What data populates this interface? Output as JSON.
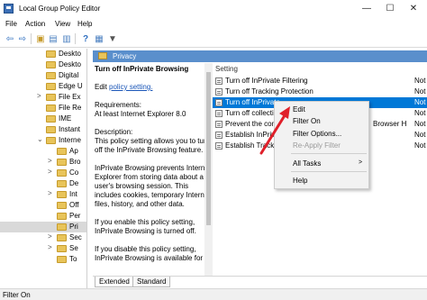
{
  "window": {
    "title": "Local Group Policy Editor",
    "minimize_glyph": "—",
    "maximize_glyph": "☐",
    "close_glyph": "✕"
  },
  "menu": [
    "File",
    "Action",
    "View",
    "Help"
  ],
  "toolbar": {
    "icons": [
      "back-arrow-icon",
      "forward-arrow-icon",
      "folder-up-icon",
      "show-tree-icon",
      "export-list-icon",
      "help-icon",
      "properties-icon",
      "filter-icon"
    ],
    "glyphs": [
      "⇦",
      "⇨",
      "▣",
      "▤",
      "▥",
      "?",
      "▦",
      "▼"
    ]
  },
  "tree": {
    "items": [
      {
        "label": "Deskto",
        "selected": false,
        "toggle": ""
      },
      {
        "label": "Deskto",
        "selected": false,
        "toggle": ""
      },
      {
        "label": "Digital",
        "selected": false,
        "toggle": ""
      },
      {
        "label": "Edge U",
        "selected": false,
        "toggle": ""
      },
      {
        "label": "File Ex",
        "selected": false,
        "toggle": ">"
      },
      {
        "label": "File Re",
        "selected": false,
        "toggle": ""
      },
      {
        "label": "IME",
        "selected": false,
        "toggle": ""
      },
      {
        "label": "Instant",
        "selected": false,
        "toggle": ""
      },
      {
        "label": "Interne",
        "selected": false,
        "toggle": "⌄"
      },
      {
        "label": "Ap",
        "selected": false,
        "toggle": ""
      },
      {
        "label": "Bro",
        "selected": false,
        "toggle": ">"
      },
      {
        "label": "Co",
        "selected": false,
        "toggle": ">"
      },
      {
        "label": "De",
        "selected": false,
        "toggle": ""
      },
      {
        "label": "Int",
        "selected": false,
        "toggle": ">"
      },
      {
        "label": "Off",
        "selected": false,
        "toggle": ""
      },
      {
        "label": "Per",
        "selected": false,
        "toggle": ""
      },
      {
        "label": "Pri",
        "selected": true,
        "toggle": ""
      },
      {
        "label": "Sec",
        "selected": false,
        "toggle": ">"
      },
      {
        "label": "Se",
        "selected": false,
        "toggle": ">"
      },
      {
        "label": "To",
        "selected": false,
        "toggle": ""
      }
    ]
  },
  "header": {
    "title": "Privacy"
  },
  "description": {
    "policy_title": "Turn off InPrivate Browsing",
    "edit_prefix": "Edit ",
    "edit_link": "policy setting.",
    "requirements_label": "Requirements:",
    "requirements_value": "At least Internet Explorer 8.0",
    "description_label": "Description:",
    "description_text": "This policy setting allows you to turn off the InPrivate Browsing feature.",
    "paragraph_2": "InPrivate Browsing prevents Internet Explorer from storing data about a user's browsing session. This includes cookies, temporary Internet files, history, and other data.",
    "paragraph_3": "If you enable this policy setting, InPrivate Browsing is turned off.",
    "paragraph_4": "If you disable this policy setting, InPrivate Browsing is available for"
  },
  "list": {
    "column_setting": "Setting",
    "rows": [
      {
        "label": "Turn off InPrivate Filtering",
        "state": "Not",
        "selected": false
      },
      {
        "label": "Turn off Tracking Protection",
        "state": "Not",
        "selected": false
      },
      {
        "label": "Turn off InPrivate",
        "state": "Not",
        "selected": true
      },
      {
        "label": "Turn off collecti",
        "state": "Not",
        "selected": false
      },
      {
        "label": "Prevent the com",
        "state": "Not",
        "selected": false,
        "tail": "Browser H"
      },
      {
        "label": "Establish InPriva",
        "state": "Not",
        "selected": false
      },
      {
        "label": "Establish Tracki",
        "state": "Not",
        "selected": false
      }
    ]
  },
  "context_menu": {
    "edit": "Edit",
    "filter_on": "Filter On",
    "filter_options": "Filter Options...",
    "reapply_filter": "Re-Apply Filter",
    "all_tasks": "All Tasks",
    "all_tasks_arrow": ">",
    "help": "Help"
  },
  "tabs": [
    "Extended",
    "Standard"
  ],
  "status": {
    "text": "Filter On"
  },
  "colors": {
    "selection": "#0078d7",
    "header_band": "#5a8fcc",
    "link": "#1a56b8",
    "annotation_arrow": "#e0202a"
  }
}
